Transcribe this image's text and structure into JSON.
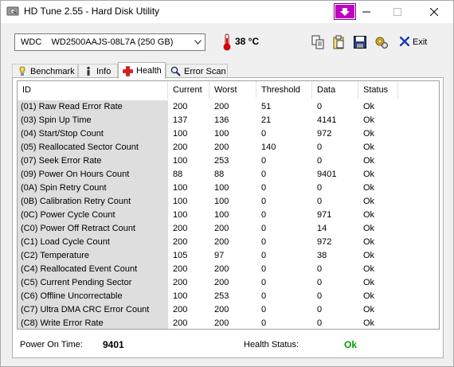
{
  "window": {
    "title": "HD Tune 2.55 - Hard Disk Utility"
  },
  "toolbar": {
    "drive_label": "WDC    WD2500AAJS-08L7A (250 GB)",
    "temperature": "38 °C",
    "exit_label": "Exit"
  },
  "tabs": [
    {
      "label": "Benchmark",
      "icon": "benchmark-icon"
    },
    {
      "label": "Info",
      "icon": "info-icon"
    },
    {
      "label": "Health",
      "icon": "health-cross-icon"
    },
    {
      "label": "Error Scan",
      "icon": "magnifier-icon"
    }
  ],
  "active_tab": "Health",
  "table": {
    "columns": [
      "ID",
      "Current",
      "Worst",
      "Threshold",
      "Data",
      "Status"
    ],
    "rows": [
      {
        "id": "(01) Raw Read Error Rate",
        "current": "200",
        "worst": "200",
        "threshold": "51",
        "data": "0",
        "status": "Ok"
      },
      {
        "id": "(03) Spin Up Time",
        "current": "137",
        "worst": "136",
        "threshold": "21",
        "data": "4141",
        "status": "Ok"
      },
      {
        "id": "(04) Start/Stop Count",
        "current": "100",
        "worst": "100",
        "threshold": "0",
        "data": "972",
        "status": "Ok"
      },
      {
        "id": "(05) Reallocated Sector Count",
        "current": "200",
        "worst": "200",
        "threshold": "140",
        "data": "0",
        "status": "Ok"
      },
      {
        "id": "(07) Seek Error Rate",
        "current": "100",
        "worst": "253",
        "threshold": "0",
        "data": "0",
        "status": "Ok"
      },
      {
        "id": "(09) Power On Hours Count",
        "current": "88",
        "worst": "88",
        "threshold": "0",
        "data": "9401",
        "status": "Ok"
      },
      {
        "id": "(0A) Spin Retry Count",
        "current": "100",
        "worst": "100",
        "threshold": "0",
        "data": "0",
        "status": "Ok"
      },
      {
        "id": "(0B) Calibration Retry Count",
        "current": "100",
        "worst": "100",
        "threshold": "0",
        "data": "0",
        "status": "Ok"
      },
      {
        "id": "(0C) Power Cycle Count",
        "current": "100",
        "worst": "100",
        "threshold": "0",
        "data": "971",
        "status": "Ok"
      },
      {
        "id": "(C0) Power Off Retract Count",
        "current": "200",
        "worst": "200",
        "threshold": "0",
        "data": "14",
        "status": "Ok"
      },
      {
        "id": "(C1) Load Cycle Count",
        "current": "200",
        "worst": "200",
        "threshold": "0",
        "data": "972",
        "status": "Ok"
      },
      {
        "id": "(C2) Temperature",
        "current": "105",
        "worst": "97",
        "threshold": "0",
        "data": "38",
        "status": "Ok"
      },
      {
        "id": "(C4) Reallocated Event Count",
        "current": "200",
        "worst": "200",
        "threshold": "0",
        "data": "0",
        "status": "Ok"
      },
      {
        "id": "(C5) Current Pending Sector",
        "current": "200",
        "worst": "200",
        "threshold": "0",
        "data": "0",
        "status": "Ok"
      },
      {
        "id": "(C6) Offline Uncorrectable",
        "current": "100",
        "worst": "253",
        "threshold": "0",
        "data": "0",
        "status": "Ok"
      },
      {
        "id": "(C7) Ultra DMA CRC Error Count",
        "current": "200",
        "worst": "200",
        "threshold": "0",
        "data": "0",
        "status": "Ok"
      },
      {
        "id": "(C8) Write Error Rate",
        "current": "200",
        "worst": "200",
        "threshold": "0",
        "data": "0",
        "status": "Ok"
      }
    ]
  },
  "summary": {
    "power_on_label": "Power On Time:",
    "power_on_value": "9401",
    "health_label": "Health Status:",
    "health_value": "Ok"
  },
  "colors": {
    "health_ok": "#00a000",
    "id_column_bg": "#dedede",
    "special_caption_button": "#c000c0"
  }
}
